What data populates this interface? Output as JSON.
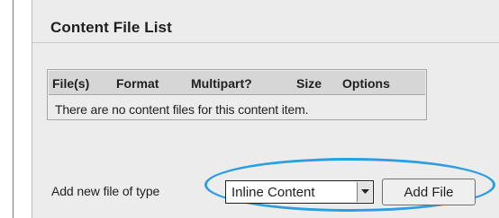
{
  "section": {
    "title": "Content File List"
  },
  "table": {
    "headers": [
      "File(s)",
      "Format",
      "Multipart?",
      "Size",
      "Options"
    ],
    "empty_message": "There are no content files for this content item."
  },
  "add_file": {
    "label": "Add new file of type",
    "selected_type": "Inline Content",
    "button_label": "Add File"
  },
  "colors": {
    "highlight_ellipse": "#2b9ee0",
    "panel_background": "#ececec",
    "table_header_background": "#d6d6d6"
  },
  "icons": {
    "select_arrow": "triangle-down-icon"
  }
}
